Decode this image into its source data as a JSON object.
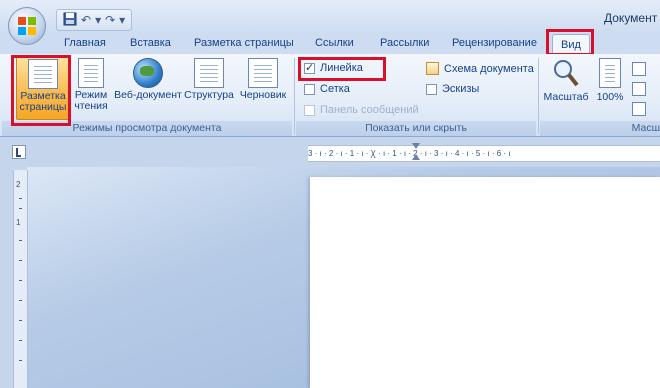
{
  "window": {
    "title": "Документ"
  },
  "qat": {
    "save_icon": "save-icon",
    "undo_glyph": "↶",
    "redo_glyph": "↷",
    "customize_glyph": "▾"
  },
  "tabs": [
    {
      "label": "Главная"
    },
    {
      "label": "Вставка"
    },
    {
      "label": "Разметка страницы"
    },
    {
      "label": "Ссылки"
    },
    {
      "label": "Рассылки"
    },
    {
      "label": "Рецензирование"
    },
    {
      "label": "Вид",
      "active": true
    }
  ],
  "groups": {
    "views": {
      "label": "Режимы просмотра документа",
      "buttons": [
        {
          "line1": "Разметка",
          "line2": "страницы",
          "icon": "page-layout-icon",
          "selected": true
        },
        {
          "line1": "Режим",
          "line2": "чтения",
          "icon": "reading-mode-icon"
        },
        {
          "line1": "Веб-документ",
          "line2": "",
          "icon": "web-layout-icon"
        },
        {
          "line1": "Структура",
          "line2": "",
          "icon": "outline-icon"
        },
        {
          "line1": "Черновик",
          "line2": "",
          "icon": "draft-icon"
        }
      ]
    },
    "show_hide": {
      "label": "Показать или скрыть",
      "items": [
        {
          "label": "Линейка",
          "checked": true,
          "enabled": true
        },
        {
          "label": "Сетка",
          "checked": false,
          "enabled": true
        },
        {
          "label": "Панель сообщений",
          "checked": false,
          "enabled": false
        },
        {
          "label": "Схема документа",
          "checked": false,
          "enabled": true
        },
        {
          "label": "Эскизы",
          "checked": false,
          "enabled": true
        }
      ]
    },
    "zoom": {
      "label": "Масш",
      "zoom_button": "Масштаб",
      "percent_button": "100%"
    }
  },
  "ruler": {
    "h_text": "3 · ı · 2 · ı · 1 · ı · Ꭓ · ı · 1 · ı · 2 · ı · 3 · ı · 4 · ı · 5 · ı · 6 · ı",
    "v_numbers": [
      "2",
      "1"
    ]
  },
  "highlight_color": "#d8102c"
}
